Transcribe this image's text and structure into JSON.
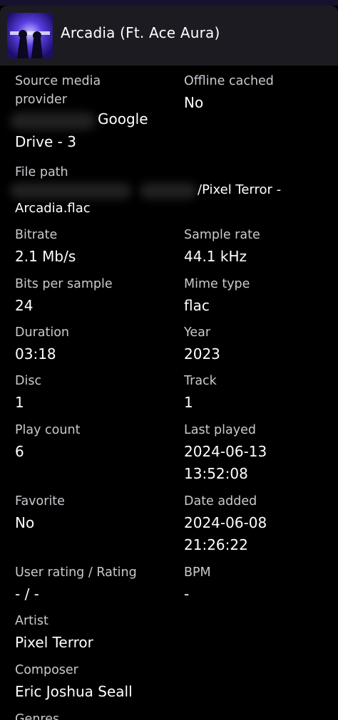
{
  "header": {
    "title": "Arcadia (Ft. Ace Aura)",
    "cover_alt": "album cover"
  },
  "source": {
    "label_line1": "Source media",
    "label_line2": "provider",
    "value_part1": "Google",
    "value_part2": "Drive - 3",
    "offline_label": "Offline cached",
    "offline_value": "No"
  },
  "file_path": {
    "label": "File path",
    "value_part1": "/Pixel Terror -",
    "value_part2": "Arcadia.flac"
  },
  "fields": {
    "bitrate": {
      "label": "Bitrate",
      "value": "2.1 Mb/s"
    },
    "sample_rate": {
      "label": "Sample rate",
      "value": "44.1 kHz"
    },
    "bits_per_sample": {
      "label": "Bits per sample",
      "value": "24"
    },
    "mime_type": {
      "label": "Mime type",
      "value": "flac"
    },
    "duration": {
      "label": "Duration",
      "value": "03:18"
    },
    "year": {
      "label": "Year",
      "value": "2023"
    },
    "disc": {
      "label": "Disc",
      "value": "1"
    },
    "track": {
      "label": "Track",
      "value": "1"
    },
    "play_count": {
      "label": "Play count",
      "value": "6"
    },
    "last_played": {
      "label": "Last played",
      "value_date": "2024-06-13",
      "value_time": "13:52:08"
    },
    "favorite": {
      "label": "Favorite",
      "value": "No"
    },
    "date_added": {
      "label": "Date added",
      "value_date": "2024-06-08",
      "value_time": "21:26:22"
    },
    "user_rating": {
      "label": "User rating / Rating",
      "value": "- / -"
    },
    "bpm": {
      "label": "BPM",
      "value": "-"
    },
    "artist": {
      "label": "Artist",
      "value": "Pixel Terror"
    },
    "composer": {
      "label": "Composer",
      "value": "Eric Joshua Seall"
    },
    "genres": {
      "label": "Genres"
    }
  },
  "colors": {
    "background": "#000000",
    "header": "#1d1b22",
    "label": "#c9c9cf",
    "value": "#ffffff"
  }
}
